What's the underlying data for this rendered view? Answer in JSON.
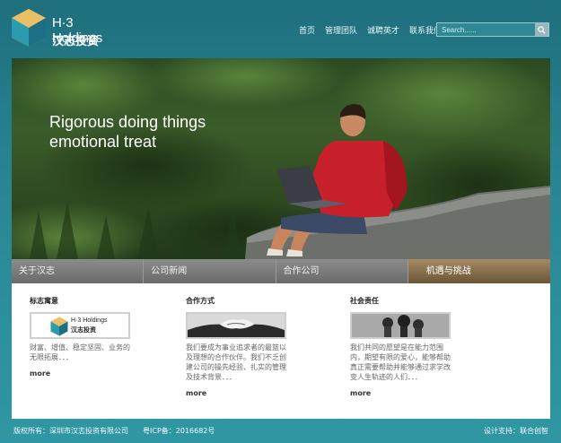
{
  "brand": {
    "name_en": "H·3 Holdings",
    "name_cn": "汉志投资"
  },
  "nav": {
    "items": [
      "首页",
      "管理团队",
      "诚聘英才",
      "联系我们"
    ]
  },
  "search": {
    "placeholder": "Search......"
  },
  "hero": {
    "line1": "Rigorous doing things",
    "line2": "emotional treat"
  },
  "tabs": [
    "关于汉志",
    "公司新闻",
    "合作公司",
    "机遇与挑战"
  ],
  "sections": [
    {
      "title": "标志寓意",
      "text": "财富、增值、稳定坚固、业务的无限拓展．．．",
      "more": "more",
      "thumb_logo_en": "H·3 Holdings",
      "thumb_logo_cn": "汉志投资"
    },
    {
      "title": "合作方式",
      "text": "我们要成为事业追求者的最篮以及理想的合作伙伴。我们不乏创建公司的操先经验、扎实的管理及技术背景．．．",
      "more": "more"
    },
    {
      "title": "社会责任",
      "text": "我们共同的愿望是在能力范围内，期望有限的爱心，能够帮助真正需要帮助并能够通过求学改变人生轨迹的人们．．．",
      "more": "more"
    }
  ],
  "footer": {
    "copyright": "版权所有：深圳市汉志投资有限公司　　粤ICP备：2016682号",
    "design": "设计支持：联合创智"
  },
  "colors": {
    "accent": "#2a8795",
    "tab_active": "#a58a62",
    "tab": "#7a7a7a"
  }
}
